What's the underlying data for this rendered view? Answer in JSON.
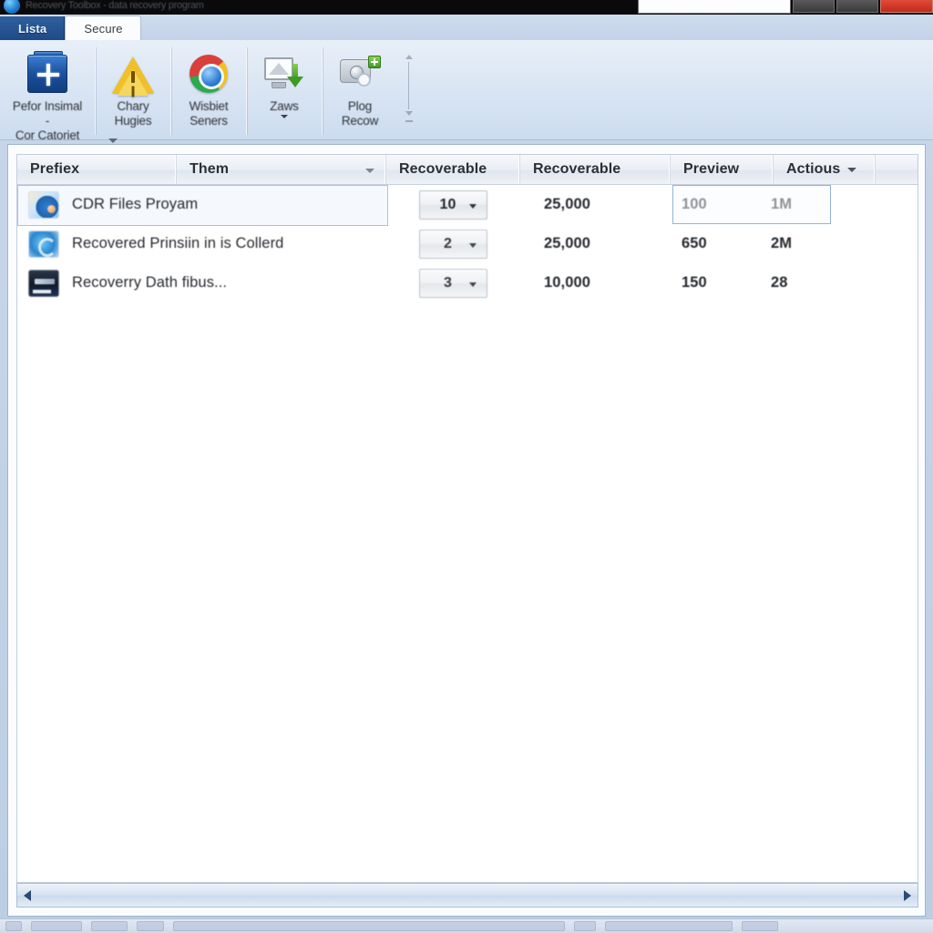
{
  "window": {
    "title": "Recovery Toolbox - data recovery program",
    "icon": "app-globe-icon",
    "search_value": "",
    "controls": {
      "minimize": "minimize-button",
      "maximize": "maximize-button",
      "close": "close-button"
    }
  },
  "tabs": [
    {
      "label": "Lista",
      "active": false,
      "name": "tab-lista"
    },
    {
      "label": "Secure",
      "active": true,
      "name": "tab-secure"
    }
  ],
  "ribbon": {
    "buttons": [
      {
        "icon": "add-device-icon",
        "line1": "Pefor Insimal",
        "line2": "-",
        "line3": "Cor Catoriet",
        "has_caret": false
      },
      {
        "icon": "warning-triangle-icon",
        "line1": "Chary",
        "line2": "Hugies",
        "line3": "",
        "has_caret": false
      },
      {
        "icon": "browser-circle-icon",
        "line1": "Wisbiet",
        "line2": "Seners",
        "line3": "",
        "has_caret": false
      },
      {
        "icon": "monitor-download-icon",
        "line1": "Zaws",
        "line2": "",
        "line3": "",
        "has_caret": true
      },
      {
        "icon": "device-scan-icon",
        "line1": "Plog",
        "line2": "Recow",
        "line3": "",
        "has_caret": false
      }
    ]
  },
  "grid": {
    "headers": [
      {
        "label": "Prefiex",
        "name": "column-header-prefix",
        "caret": false,
        "inline_caret": false
      },
      {
        "label": "Them",
        "name": "column-header-them",
        "caret": true,
        "inline_caret": false
      },
      {
        "label": "Recoverable",
        "name": "column-header-recoverable-1",
        "caret": false,
        "inline_caret": false
      },
      {
        "label": "Recoverable",
        "name": "column-header-recoverable-2",
        "caret": false,
        "inline_caret": false
      },
      {
        "label": "Preview",
        "name": "column-header-preview",
        "caret": false,
        "inline_caret": false
      },
      {
        "label": "Actious",
        "name": "column-header-actions",
        "caret": false,
        "inline_caret": true
      }
    ],
    "rows": [
      {
        "icon": "file-recovery-icon",
        "them": "CDR Files Proyam",
        "count": "10",
        "recoverable": "25,000",
        "preview": "100",
        "actions": "1M",
        "selected": true
      },
      {
        "icon": "disc-recovery-icon",
        "them": "Recovered Prinsiin in is Collerd",
        "count": "2",
        "recoverable": "25,000",
        "preview": "650",
        "actions": "2M",
        "selected": false
      },
      {
        "icon": "drive-recovery-icon",
        "them": "Recoverry Dath fibus...",
        "count": "3",
        "recoverable": "10,000",
        "preview": "150",
        "actions": "28",
        "selected": false
      }
    ]
  },
  "scrollbar": {
    "left_arrow": "scroll-left-icon",
    "right_arrow": "scroll-right-icon"
  },
  "colors": {
    "accent_blue": "#1d4a86",
    "selection_border": "#8fb3dc",
    "ribbon_bg": "#dbe6f4",
    "close_red": "#c22a19"
  }
}
